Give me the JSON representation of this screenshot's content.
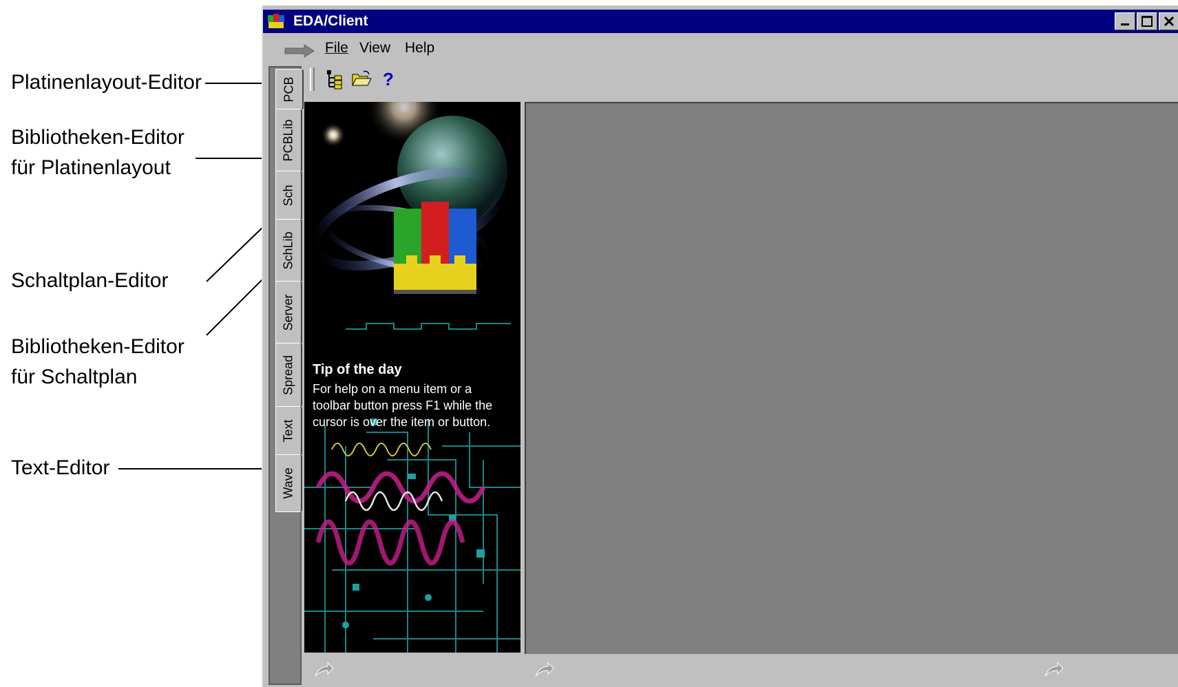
{
  "annotations": {
    "pcb": "Platinenlayout-Editor",
    "pcblib_line1": "Bibliotheken-Editor",
    "pcblib_line2": "für Platinenlayout",
    "sch": "Schaltplan-Editor",
    "schlib_line1": "Bibliotheken-Editor",
    "schlib_line2": "für Schaltplan",
    "text": "Text-Editor"
  },
  "window": {
    "title": "EDA/Client"
  },
  "menu": {
    "file": "File",
    "view": "View",
    "help": "Help"
  },
  "toolbar": {
    "icons": [
      "design-tree-icon",
      "open-folder-icon",
      "help-icon"
    ]
  },
  "tabs": [
    "PCB",
    "PCBLib",
    "Sch",
    "SchLib",
    "Server",
    "Spread",
    "Text",
    "Wave"
  ],
  "splash": {
    "tip_title": "Tip of the day",
    "tip_body": "For help on a menu item or a toolbar button press F1 while the cursor is over the item or button."
  },
  "colors": {
    "titlebar": "#000080",
    "workspace": "#808080",
    "window_face": "#c0c0c0"
  }
}
